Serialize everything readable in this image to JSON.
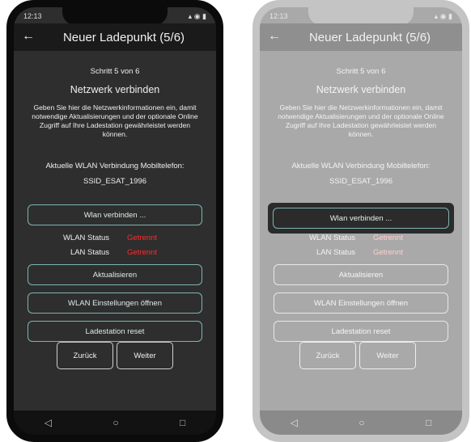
{
  "status": {
    "time": "12:13"
  },
  "header": {
    "back_icon": "arrow-left-icon",
    "title": "Neuer Ladepunkt (5/6)"
  },
  "step": "Schritt 5 von 6",
  "heading": "Netzwerk verbinden",
  "description": "Geben Sie hier die Netzwerkinformationen ein, damit notwendige Aktualisierungen und der optionale Online Zugriff auf Ihre Ladestation gewährleistet werden können.",
  "current_connection_label": "Aktuelle WLAN Verbindung Mobiltelefon:",
  "ssid": "SSID_ESAT_1996",
  "buttons": {
    "connect_wlan": "Wlan verbinden ...",
    "refresh": "Aktualisieren",
    "open_wlan_settings": "WLAN Einstellungen öffnen",
    "reset_station": "Ladestation reset",
    "back": "Zurück",
    "next": "Weiter"
  },
  "status_rows": [
    {
      "label": "WLAN Status",
      "value": "Getrennt"
    },
    {
      "label": "LAN Status",
      "value": "Getrennt"
    }
  ],
  "system_nav": {
    "back": "◁",
    "home": "○",
    "recents": "□"
  },
  "colors": {
    "accent_border": "#7fb3b3",
    "status_disconnected": "#ff2a2a"
  }
}
